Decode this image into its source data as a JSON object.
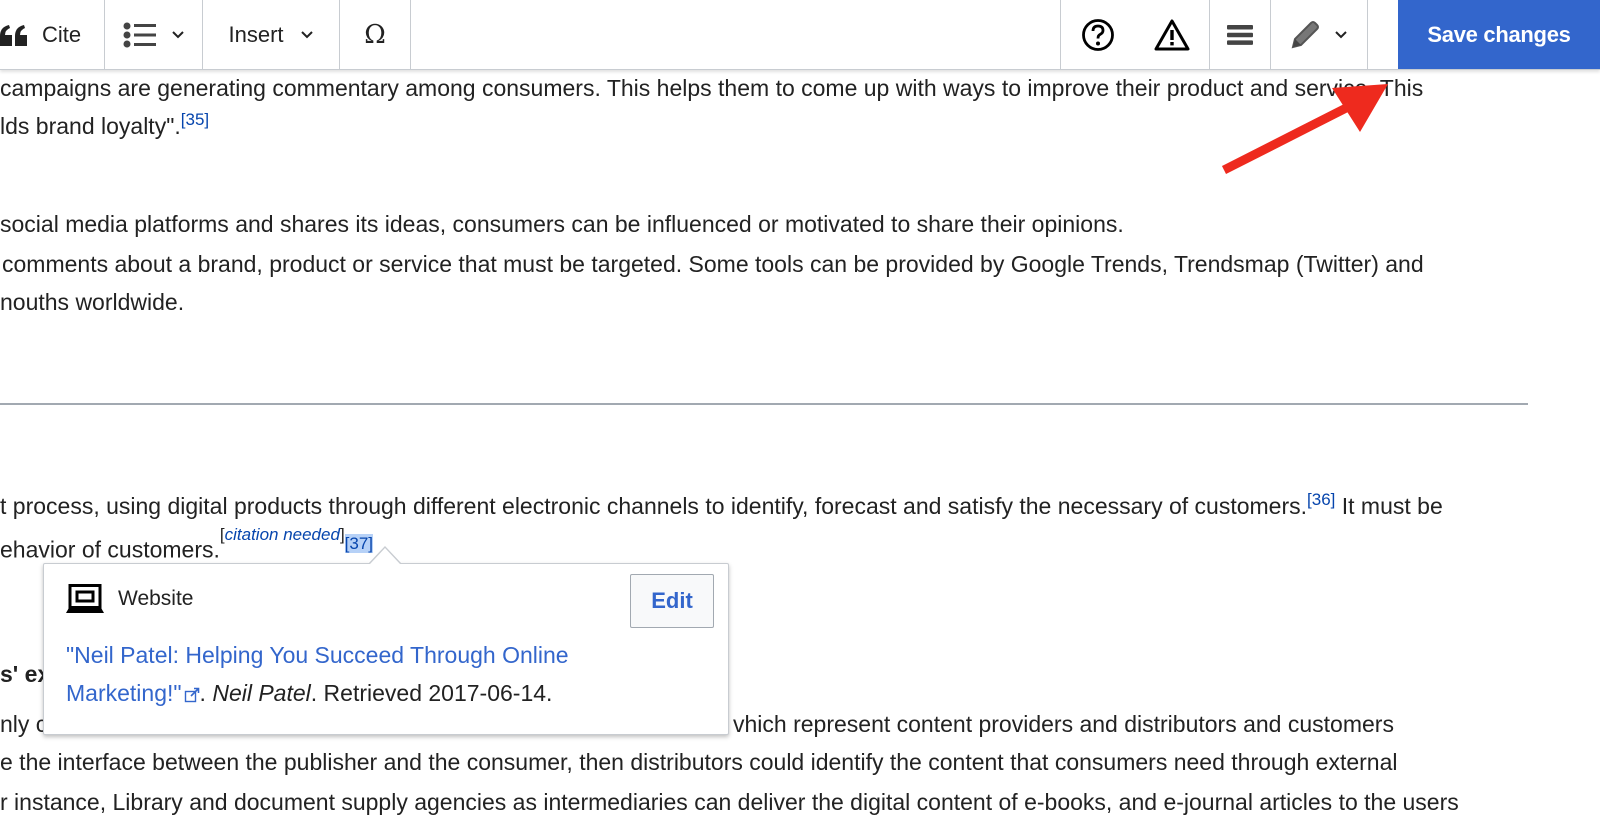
{
  "toolbar": {
    "cite_label": "Cite",
    "insert_label": "Insert",
    "special_char_symbol": "Ω",
    "save_label": "Save changes",
    "icons": [
      "cite-quote-icon",
      "bulleted-list-icon",
      "chevron-down-icon",
      "omega-special-character-icon",
      "help-icon",
      "warning-icon",
      "page-options-menu-icon",
      "edit-pencil-icon"
    ]
  },
  "content": {
    "para1": {
      "line1": "campaigns are generating commentary among consumers. This helps them to come up with ways to improve their product and service. This",
      "line2": "lds brand loyalty\".",
      "ref": "[35]"
    },
    "para2": {
      "line1": "social media platforms and shares its ideas, consumers can be influenced or motivated to share their opinions.",
      "line2": "comments about a brand, product or service that must be targeted. Some tools can be provided by Google Trends, Trendsmap (Twitter) and",
      "line3": "nouths worldwide."
    },
    "para3": {
      "line1": "t process, using digital products through different electronic channels to identify, forecast and satisfy the necessary of customers.",
      "ref36": "[36]",
      "line1_end": " It must be",
      "line2": "ehavior of customers.",
      "citation_needed": "citation needed",
      "ref37": "[37]"
    },
    "section_heading_fragment": "s' ex",
    "para4": {
      "line1_start": "nly c",
      "line1_end": "vhich represent content providers and distributors and customers",
      "line2": "e the interface between the publisher and the consumer, then distributors could identify the content that consumers need through external",
      "line3": "r instance, Library and document supply agencies as intermediaries can deliver the digital content of e-books, and e-journal articles to the users"
    }
  },
  "popup": {
    "type_icon": "website-icon",
    "type_label": "Website",
    "edit_label": "Edit",
    "link_title": "\"Neil Patel: Helping You Succeed Through Online Marketing!\"",
    "link_line1": "\"Neil Patel: Helping You Succeed Through Online",
    "link_line2": "Marketing!\"",
    "publisher": "Neil Patel",
    "retrieved": "Retrieved 2017-06-14."
  },
  "annotation": {
    "type": "arrow",
    "color": "#ee2a1e",
    "points_to": "save-changes-button"
  },
  "colors": {
    "accent": "#3366cc",
    "link": "#0645ad",
    "selection": "#b6d1f7"
  }
}
